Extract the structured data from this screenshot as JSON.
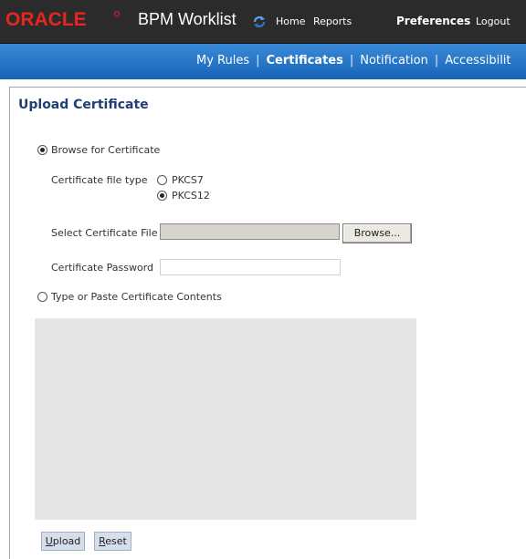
{
  "header": {
    "logo_text": "ORACLE",
    "app_title": "BPM Worklist",
    "refresh_icon": "refresh-icon",
    "nav": [
      "Home",
      "Reports",
      "Preferences",
      "Logout"
    ]
  },
  "tabs": {
    "items": [
      "My Rules",
      "Certificates",
      "Notification",
      "Accessibilit"
    ],
    "active_index": 1,
    "separator": "|"
  },
  "page": {
    "title": "Upload Certificate",
    "browse_option_label": "Browse for Certificate",
    "browse_option_selected": true,
    "file_type_label": "Certificate file type",
    "file_types": [
      "PKCS7",
      "PKCS12"
    ],
    "file_type_selected": "PKCS12",
    "select_file_label": "Select Certificate File",
    "select_file_value": "",
    "browse_button_label": "Browse...",
    "password_label": "Certificate Password",
    "password_value": "",
    "paste_option_label": "Type or Paste Certificate Contents",
    "paste_option_selected": false,
    "contents_value": "",
    "upload_button_label_first": "U",
    "upload_button_label_rest": "pload",
    "reset_button_label_first": "R",
    "reset_button_label_rest": "eset"
  },
  "colors": {
    "header_bg": "#2b2b2b",
    "oracle_red": "#e8261f",
    "tab_bar": "#1764b7",
    "title": "#1f3f74"
  }
}
